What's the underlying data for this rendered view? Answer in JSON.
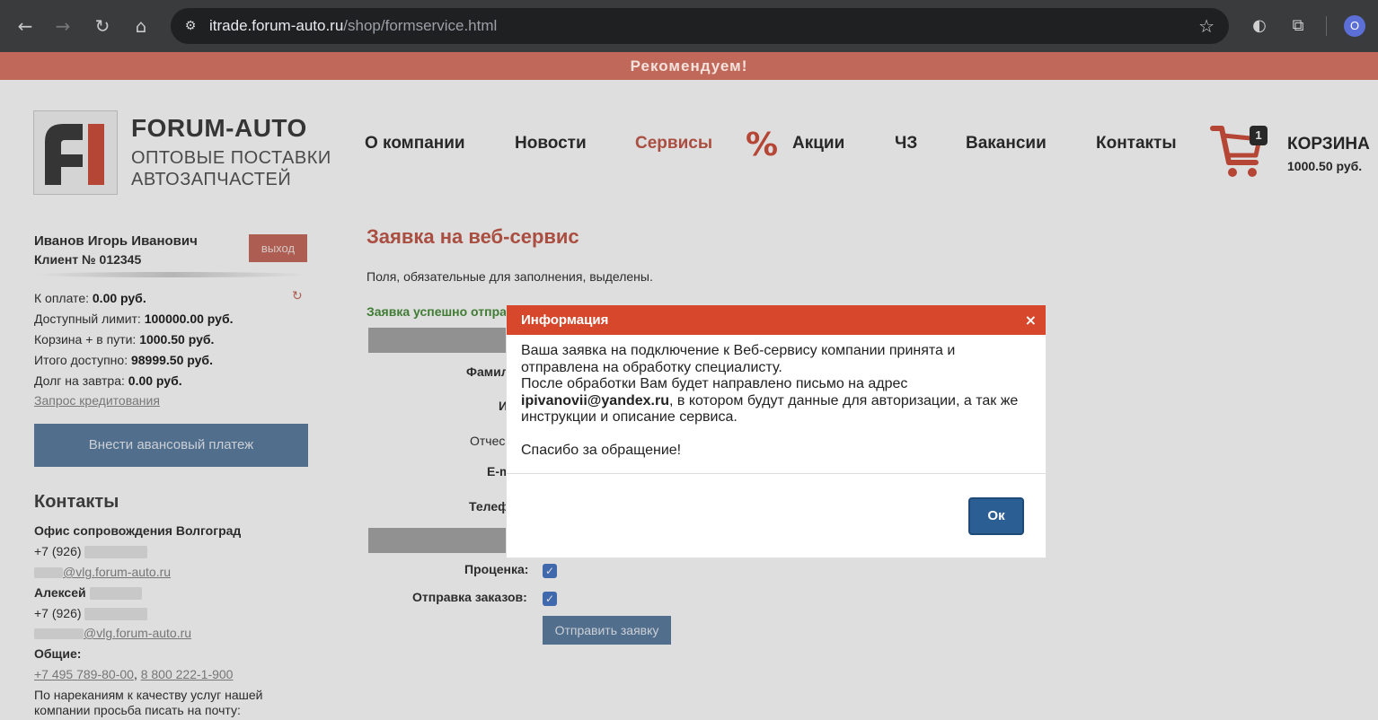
{
  "browser": {
    "url_host": "itrade.forum-auto.ru",
    "url_path": "/shop/formservice.html",
    "profile_initial": "O"
  },
  "promo": {
    "text": "Рекомендуем!"
  },
  "header": {
    "logo_title": "FORUM-AUTO",
    "logo_sub_1": "ОПТОВЫЕ ПОСТАВКИ",
    "logo_sub_2": "АВТОЗАПЧАСТЕЙ",
    "menu": {
      "about": "О компании",
      "news": "Новости",
      "services": "Сервисы",
      "promo": "Акции",
      "cz": "ЧЗ",
      "jobs": "Вакансии",
      "contacts": "Контакты"
    },
    "cart": {
      "badge": "1",
      "title": "КОРЗИНА",
      "sum": "1000.50 руб."
    }
  },
  "sidebar": {
    "user_name": "Иванов Игорь Иванович",
    "client_no": "Клиент № 012345",
    "logout": "выход",
    "finance": [
      {
        "label": "К оплате: ",
        "value": "0.00 руб."
      },
      {
        "label": "Доступный лимит: ",
        "value": "100000.00 руб."
      },
      {
        "label": "Корзина + в пути: ",
        "value": "1000.50 руб."
      },
      {
        "label": "Итого доступно: ",
        "value": "98999.50 руб."
      },
      {
        "label": "Долг на завтра: ",
        "value": "0.00 руб."
      }
    ],
    "credit_link": "Запрос кредитования",
    "advance_button": "Внести авансовый платеж",
    "contacts_title": "Контакты",
    "office_title": "Офис сопровождения Волгоград",
    "office_phone": "+7 (926)",
    "office_email": "@vlg.forum-auto.ru",
    "person_name": "Алексей",
    "person_phone": "+7 (926)",
    "person_email": "@vlg.forum-auto.ru",
    "general_title": "Общие:",
    "general_phone_1": "+7 495 789-80-00",
    "general_phone_sep": ",",
    "general_phone_2": "8 800 222-1-900",
    "complaint_1": "По нареканиям к качеству услуг нашей",
    "complaint_2": "компании просьба писать на почту:"
  },
  "main": {
    "title": "Заявка на веб-сервис",
    "note": "Поля, обязательные для заполнения, выделены.",
    "success": "Заявка успешно отпра",
    "labels": {
      "surname": "Фамил",
      "name": "И",
      "patronymic": "Отчес",
      "email": "E-m",
      "phone": "Телеф",
      "pricing": "Проценка:",
      "orders": "Отправка заказов:"
    },
    "submit": "Отправить заявку"
  },
  "modal": {
    "title": "Информация",
    "close": "×",
    "line1": "Ваша заявка на подключение к Веб-сервису компании принята и",
    "line2": "отправлена на обработку специалисту.",
    "line3": "После обработки Вам будет направлено письмо на адрес",
    "email": "ipivanovii@yandex.ru",
    "line4_rest": ", в котором будут данные для авторизации, а так же",
    "line5": "инструкции и описание сервиса.",
    "thanks": "Спасибо за обращение!",
    "ok": "Ок"
  },
  "colors": {
    "accent": "#c45a4b",
    "modal_header": "#d6472c",
    "button_blue": "#5e7fa3",
    "ok_blue": "#2b5f94",
    "success_green": "#4a8f3c"
  }
}
